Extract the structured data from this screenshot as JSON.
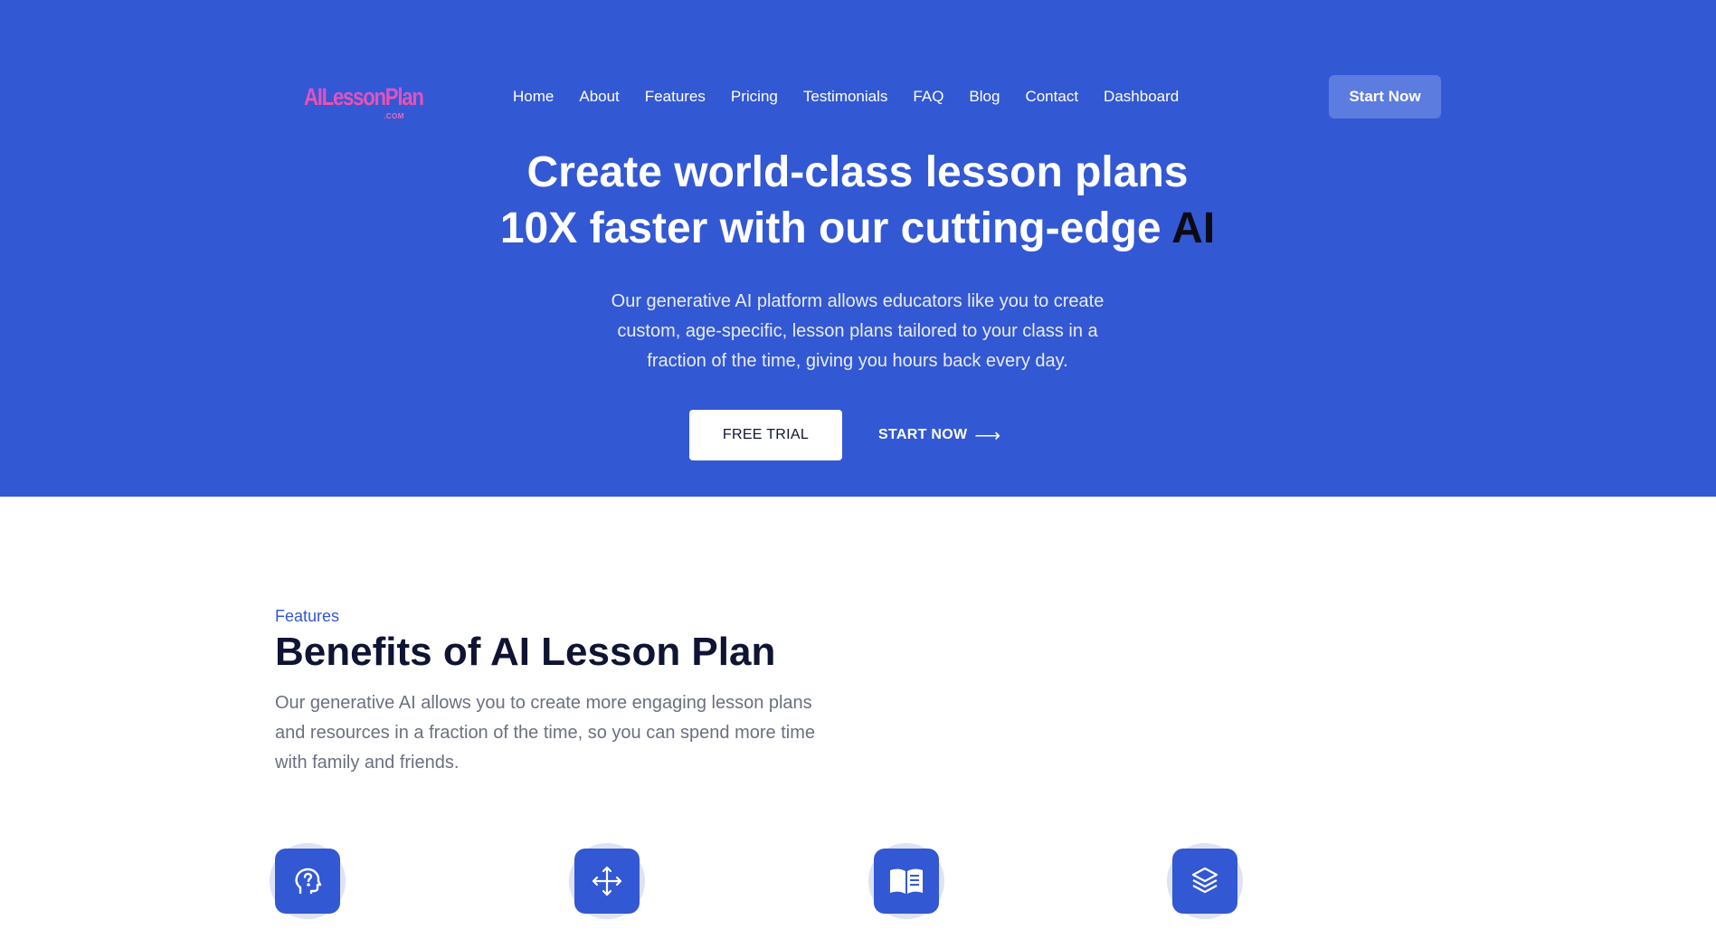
{
  "header": {
    "logo_text": "AILessonPlan",
    "logo_suffix": ".COM",
    "nav": [
      "Home",
      "About",
      "Features",
      "Pricing",
      "Testimonials",
      "FAQ",
      "Blog",
      "Contact",
      "Dashboard"
    ],
    "cta_label": "Start Now"
  },
  "hero": {
    "title_line1": "Create world-class lesson plans",
    "title_line2_main": "10X faster with our cutting-edge ",
    "title_line2_accent": "AI",
    "description": "Our generative AI platform allows educators like you to create custom, age-specific, lesson plans tailored to your class in a fraction of the time, giving you hours back every day.",
    "free_trial_label": "FREE TRIAL",
    "start_now_label": "START NOW",
    "start_now_arrow": "⟶"
  },
  "features": {
    "kicker": "Features",
    "title": "Benefits of AI Lesson Plan",
    "description": "Our generative AI allows you to create more engaging lesson plans and resources in a fraction of the time, so you can spend more time with family and friends.",
    "icons": [
      "head-question-icon",
      "move-arrows-icon",
      "open-book-icon",
      "layers-icon"
    ]
  },
  "colors": {
    "hero_bg": "#3358d4",
    "accent": "#3358d4",
    "title_dark": "#0f1433"
  }
}
